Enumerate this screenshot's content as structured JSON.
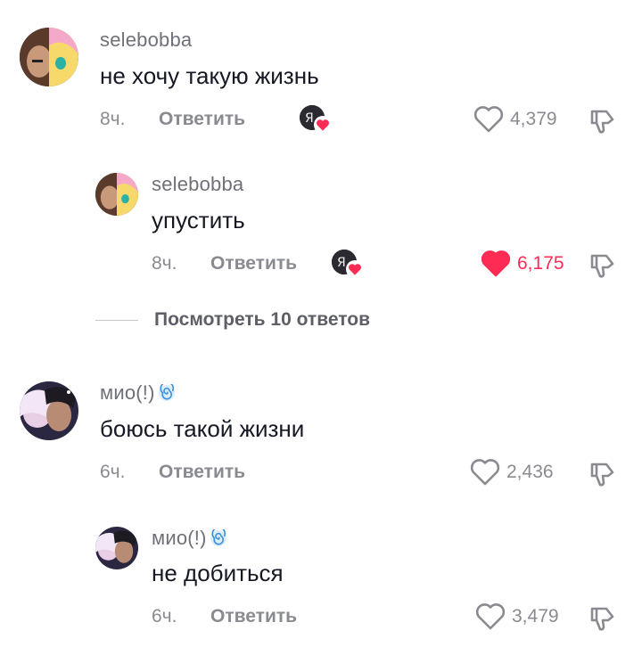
{
  "comments": [
    {
      "username": "selebobba",
      "text": "не хочу такую жизнь",
      "time": "8ч.",
      "reply_label": "Ответить",
      "likes": "4,379",
      "liked": false,
      "liked_by_creator": true,
      "replies": [
        {
          "username": "selebobba",
          "text": "упустить",
          "time": "8ч.",
          "reply_label": "Ответить",
          "likes": "6,175",
          "liked": true,
          "liked_by_creator": true
        }
      ],
      "view_replies_label": "Посмотреть 10 ответов"
    },
    {
      "username": "мио(!)",
      "text": "боюсь такой жизни",
      "time": "6ч.",
      "reply_label": "Ответить",
      "likes": "2,436",
      "liked": false,
      "liked_by_creator": false,
      "replies": [
        {
          "username": "мио(!)",
          "text": "не добиться",
          "time": "6ч.",
          "reply_label": "Ответить",
          "likes": "3,479",
          "liked": false,
          "liked_by_creator": false
        }
      ]
    }
  ],
  "colors": {
    "like_active": "#fe2c55",
    "muted": "#8a8b91",
    "text": "#161823"
  },
  "icons": [
    "heart-outline-icon",
    "heart-filled-icon",
    "thumbs-down-icon",
    "spiral-emoji-icon"
  ]
}
